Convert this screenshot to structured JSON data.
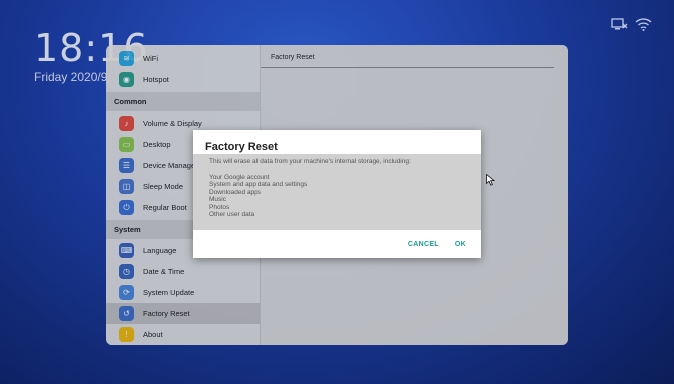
{
  "status": {
    "time": "18:16",
    "date": "Friday 2020/9,"
  },
  "settings": {
    "sections": [
      {
        "header": "Common"
      },
      {
        "header": "System"
      }
    ],
    "items": [
      {
        "label": "WiFi",
        "icon": "wifi-icon",
        "color": "#2ba6d9"
      },
      {
        "label": "Hotspot",
        "icon": "hotspot-icon",
        "color": "#2b9c86"
      },
      {
        "label": "Volume & Display",
        "icon": "volume-display-icon",
        "color": "#e04a3a"
      },
      {
        "label": "Desktop",
        "icon": "desktop-icon",
        "color": "#8bc34a"
      },
      {
        "label": "Device Manage",
        "icon": "device-manage-icon",
        "color": "#3f6fc5"
      },
      {
        "label": "Sleep Mode",
        "icon": "sleep-mode-icon",
        "color": "#4a73c9"
      },
      {
        "label": "Regular Boot",
        "icon": "regular-boot-icon",
        "color": "#3a6fd0"
      },
      {
        "label": "Language",
        "icon": "language-icon",
        "color": "#3b63b8"
      },
      {
        "label": "Date & Time",
        "icon": "date-time-icon",
        "color": "#3a64ba"
      },
      {
        "label": "System Update",
        "icon": "system-update-icon",
        "color": "#4a86d8"
      },
      {
        "label": "Factory Reset",
        "icon": "factory-reset-icon",
        "color": "#3f6fc5"
      },
      {
        "label": "About",
        "icon": "about-icon",
        "color": "#f0b90e"
      }
    ],
    "content_title": "Factory Reset"
  },
  "dialog": {
    "title": "Factory Reset",
    "intro": "This will erase all data from your machine's internal storage, including:",
    "items": [
      "Your Google account",
      "System and app data and settings",
      "Downloaded apps",
      "Music",
      "Photos",
      "Other user data"
    ],
    "cancel_label": "CANCEL",
    "ok_label": "OK",
    "accent": "#1a9e8e"
  }
}
